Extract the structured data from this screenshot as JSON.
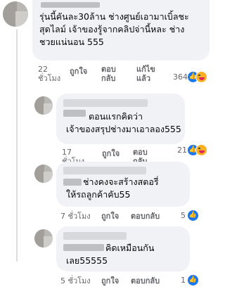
{
  "comments": [
    {
      "text": "รุ่นนี้คันละ30ล้าน ช่างศูนย์เอามาเบิ้ลชะ\nสุดไลม์ เจ้าของรู้จากคลิปจ่านี้หละ ช่าง\nชวยแน่นอน 555",
      "time": "22 ชั่วโมง",
      "like": "ถูกใจ",
      "reply": "ตอบกลับ",
      "edit": "แก้ไขแล้ว",
      "count": "364"
    },
    {
      "text": "ตอนแรกคิดว่า\nเจ้าของสรุปช่างมาเอาลอง555",
      "time": "17 ชั่วโมง",
      "like": "ถูกใจ",
      "reply": "ตอบกลับ",
      "count": "21"
    },
    {
      "text": "ช่างคงจะสร้างสตอรี่\nให้รถลูกค้าคับ55",
      "time": "7 ชั่วโมง",
      "like": "ถูกใจ",
      "reply": "ตอบกลับ",
      "count": "5"
    },
    {
      "text": "คิดเหมือนกัน\nเลย55555",
      "time": "5 ชั่วโมง",
      "like": "ถูกใจ",
      "reply": "ตอบกลับ",
      "count": "1"
    }
  ],
  "icons": {
    "like": "thumbs-up-icon",
    "haha": "laughing-face-icon"
  },
  "colors": {
    "bubble": "#f0f2f5",
    "meta": "#65676b",
    "like_blue": "#1877f2",
    "haha_yellow": "#f7b125"
  }
}
